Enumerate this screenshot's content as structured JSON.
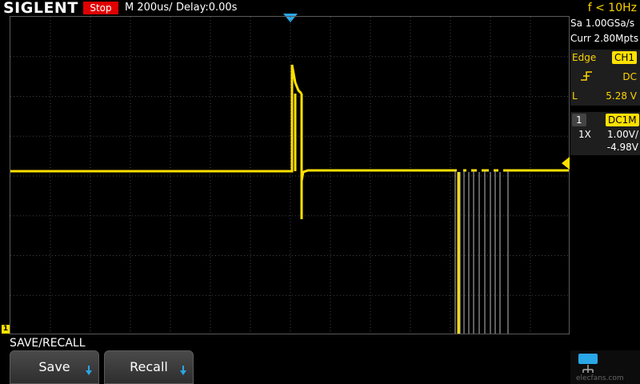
{
  "header": {
    "brand": "SIGLENT",
    "status": "Stop",
    "timebase": "M 200us/",
    "delay": "Delay:0.00s",
    "frequency": "f < 10Hz"
  },
  "acquisition": {
    "sample_rate": "Sa 1.00GSa/s",
    "memory": "Curr 2.80Mpts"
  },
  "trigger": {
    "type": "Edge",
    "source": "CH1",
    "slope_icon": "rising-edge-icon",
    "coupling": "DC",
    "level_label": "L",
    "level": "5.28 V"
  },
  "channel": {
    "number": "1",
    "coupling": "DC1M",
    "probe": "1X",
    "scale": "1.00V/",
    "offset": "-4.98V"
  },
  "menu": {
    "title": "SAVE/RECALL",
    "buttons": [
      "Save",
      "Recall"
    ]
  },
  "markers": {
    "channel_marker": "1"
  },
  "watermark": "elecfans.com",
  "colors": {
    "trace": "#ffe100",
    "accent": "#2aa7e6",
    "stop": "#e00000"
  }
}
